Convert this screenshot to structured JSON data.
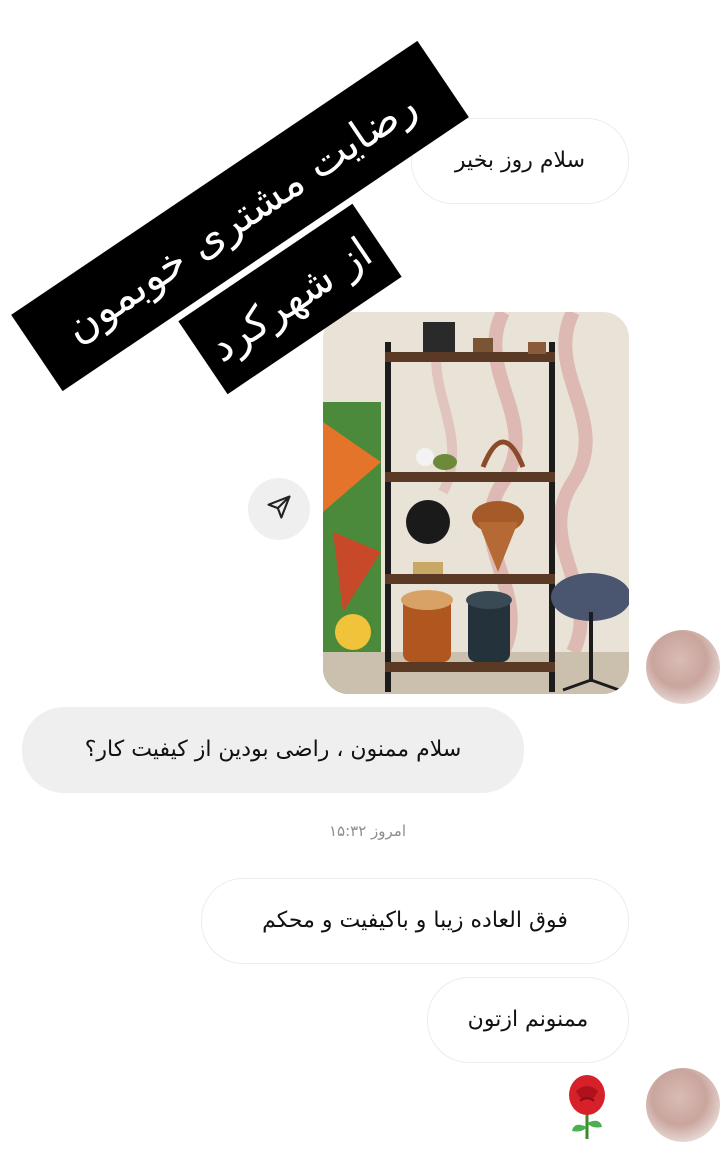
{
  "overlay": {
    "line1": "رضایت مشتری خوبمون",
    "line2": "از شهرکرد"
  },
  "messages": {
    "first": "سلام روز بخیر",
    "question": "سلام ممنون ، راضی بودین از کیفیت کار؟",
    "timestamp": "امروز ۱۵:۳۲",
    "reply1": "فوق العاده زیبا و باکیفیت و محکم",
    "reply2": "ممنونم ازتون"
  },
  "icons": {
    "share": "send-arrow-icon",
    "rose": "rose-emoji-icon"
  },
  "colors": {
    "bubble_fill": "#efefef",
    "bubble_border": "#ececec",
    "timestamp": "#8e8e8e",
    "banner": "#000000"
  }
}
